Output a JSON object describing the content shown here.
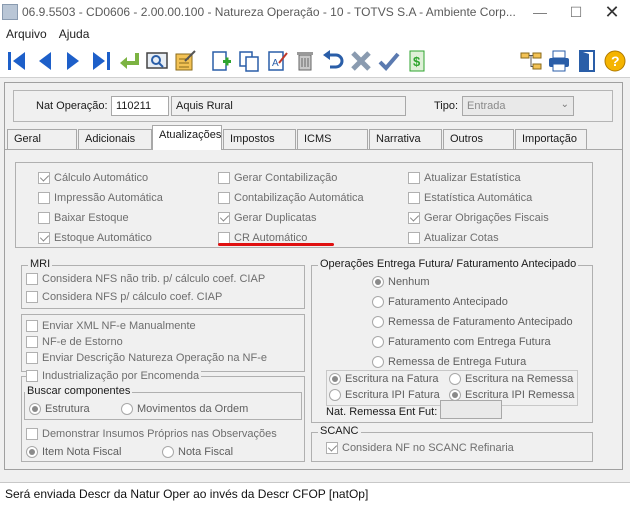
{
  "window": {
    "title": "06.9.5503 - CD0606 - 2.00.00.100 - Natureza Operação - 10 - TOTVS S.A - Ambiente Corp..."
  },
  "menu": {
    "items": [
      {
        "label": "Arquivo"
      },
      {
        "label": "Ajuda"
      }
    ]
  },
  "toolbar": {
    "buttons": [
      {
        "icon": "first-record-icon"
      },
      {
        "icon": "previous-record-icon"
      },
      {
        "icon": "next-record-icon"
      },
      {
        "icon": "last-record-icon"
      },
      {
        "icon": "goto-icon"
      },
      {
        "icon": "search-icon"
      },
      {
        "icon": "list-icon"
      },
      {
        "icon": "new-record-icon"
      },
      {
        "icon": "copy-record-icon"
      },
      {
        "icon": "edit-record-icon"
      },
      {
        "icon": "delete-icon"
      },
      {
        "icon": "undo-icon"
      },
      {
        "icon": "cancel-icon"
      },
      {
        "icon": "confirm-icon"
      },
      {
        "icon": "currency-icon"
      },
      {
        "icon": "tree-icon"
      },
      {
        "icon": "print-icon"
      },
      {
        "icon": "exit-icon"
      },
      {
        "icon": "help-icon"
      }
    ]
  },
  "header": {
    "nat_label": "Nat Operação:",
    "nat_code": "110211",
    "nat_desc": "Aquis Rural",
    "tipo_label": "Tipo:",
    "tipo_value": "Entrada"
  },
  "tabs": [
    {
      "label": "Geral"
    },
    {
      "label": "Adicionais"
    },
    {
      "label": "Atualizações"
    },
    {
      "label": "Impostos"
    },
    {
      "label": "ICMS"
    },
    {
      "label": "Narrativa"
    },
    {
      "label": "Outros"
    },
    {
      "label": "Importação"
    }
  ],
  "atualizacoes": {
    "col1": [
      {
        "label": "Cálculo Automático",
        "checked": true
      },
      {
        "label": "Impressão Automática",
        "checked": false
      },
      {
        "label": "Baixar Estoque",
        "checked": false
      },
      {
        "label": "Estoque Automático",
        "checked": true
      }
    ],
    "col2": [
      {
        "label": "Gerar Contabilização",
        "checked": false
      },
      {
        "label": "Contabilização Automática",
        "checked": false
      },
      {
        "label": "Gerar Duplicatas",
        "checked": true
      },
      {
        "label": "CR Automático",
        "checked": false
      }
    ],
    "col3": [
      {
        "label": "Atualizar Estatística",
        "checked": false
      },
      {
        "label": "Estatística Automática",
        "checked": false
      },
      {
        "label": "Gerar Obrigações Fiscais",
        "checked": true
      },
      {
        "label": "Atualizar Cotas",
        "checked": false
      }
    ]
  },
  "mri": {
    "title": "MRI",
    "items": [
      {
        "label": "Considera NFS não trib. p/ cálculo coef. CIAP",
        "checked": false
      },
      {
        "label": "Considera NFS p/ cálculo coef. CIAP",
        "checked": false
      }
    ]
  },
  "nfe": {
    "items": [
      {
        "label": "Enviar XML NF-e Manualmente",
        "checked": false
      },
      {
        "label": "NF-e de Estorno",
        "checked": false
      },
      {
        "label": "Enviar Descrição Natureza Operação na NF-e",
        "checked": false
      }
    ]
  },
  "industrializacao": {
    "label": "Industrialização por Encomenda",
    "buscar_title": "Buscar componentes",
    "buscar_options": [
      {
        "label": "Estrutura",
        "selected": true
      },
      {
        "label": "Movimentos da Ordem",
        "selected": false
      }
    ],
    "demonstrar_label": "Demonstrar Insumos Próprios nas Observações",
    "nota_options": [
      {
        "label": "Item Nota Fiscal",
        "selected": true
      },
      {
        "label": "Nota Fiscal",
        "selected": false
      }
    ]
  },
  "entrega_futura": {
    "title": "Operações Entrega Futura/ Faturamento Antecipado",
    "options": [
      {
        "label": "Nenhum",
        "selected": true
      },
      {
        "label": "Faturamento Antecipado",
        "selected": false
      },
      {
        "label": "Remessa de Faturamento Antecipado",
        "selected": false
      },
      {
        "label": "Faturamento com Entrega Futura",
        "selected": false
      },
      {
        "label": "Remessa de Entrega Futura",
        "selected": false
      }
    ],
    "escritura_options": [
      {
        "label": "Escritura na Fatura",
        "selected": true
      },
      {
        "label": "Escritura na Remessa",
        "selected": false
      },
      {
        "label": "Escritura IPI Fatura",
        "selected": false
      },
      {
        "label": "Escritura IPI Remessa",
        "selected": true
      }
    ],
    "nat_remessa_label": "Nat. Remessa Ent Fut:",
    "nat_remessa_value": ""
  },
  "scanc": {
    "title": "SCANC",
    "item": {
      "label": "Considera NF no SCANC Refinaria",
      "checked": true
    }
  },
  "status": {
    "text": "Será enviada Descr da Natur Oper ao invés da Descr CFOP [natOp]"
  }
}
